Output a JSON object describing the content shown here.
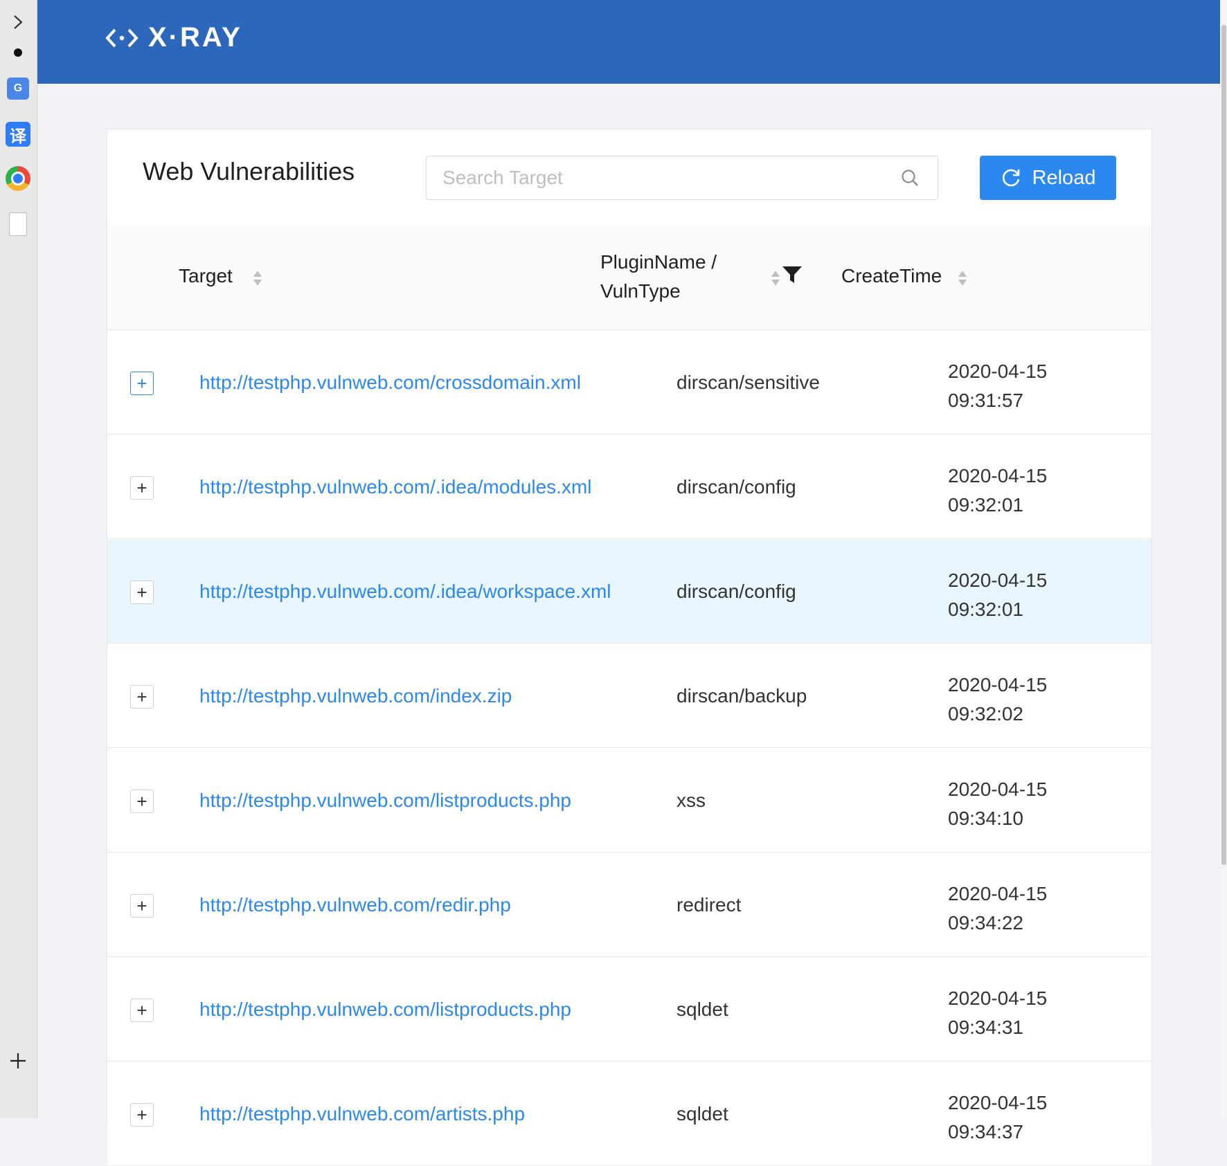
{
  "app": {
    "logo_text": "X·RAY"
  },
  "card": {
    "title": "Web Vulnerabilities"
  },
  "search": {
    "placeholder": "Search Target",
    "value": ""
  },
  "reload": {
    "label": "Reload"
  },
  "colors": {
    "header": "#2c67bc",
    "accent": "#2b88ef",
    "row_highlight": "#e8f5fc"
  },
  "table": {
    "columns": [
      {
        "label": "Target",
        "sortable": true
      },
      {
        "label_line1": "PluginName /",
        "label_line2": "VulnType",
        "sortable": true,
        "filter": true
      },
      {
        "label": "CreateTime",
        "sortable": true
      }
    ],
    "rows": [
      {
        "target": "http://testphp.vulnweb.com/crossdomain.xml",
        "plugin": "dirscan/sensitive",
        "date": "2020-04-15",
        "time": "09:31:57"
      },
      {
        "target": "http://testphp.vulnweb.com/.idea/modules.xml",
        "plugin": "dirscan/config",
        "date": "2020-04-15",
        "time": "09:32:01"
      },
      {
        "target": "http://testphp.vulnweb.com/.idea/workspace.xml",
        "plugin": "dirscan/config",
        "date": "2020-04-15",
        "time": "09:32:01"
      },
      {
        "target": "http://testphp.vulnweb.com/index.zip",
        "plugin": "dirscan/backup",
        "date": "2020-04-15",
        "time": "09:32:02"
      },
      {
        "target": "http://testphp.vulnweb.com/listproducts.php",
        "plugin": "xss",
        "date": "2020-04-15",
        "time": "09:34:10"
      },
      {
        "target": "http://testphp.vulnweb.com/redir.php",
        "plugin": "redirect",
        "date": "2020-04-15",
        "time": "09:34:22"
      },
      {
        "target": "http://testphp.vulnweb.com/listproducts.php",
        "plugin": "sqldet",
        "date": "2020-04-15",
        "time": "09:34:31"
      },
      {
        "target": "http://testphp.vulnweb.com/artists.php",
        "plugin": "sqldet",
        "date": "2020-04-15",
        "time": "09:34:37"
      }
    ]
  },
  "sidebar_icons": [
    "chevron-right-icon",
    "dot-icon",
    "google-translate-icon",
    "translate-icon",
    "chrome-extension-icon",
    "html-file-icon",
    "plus-icon"
  ]
}
